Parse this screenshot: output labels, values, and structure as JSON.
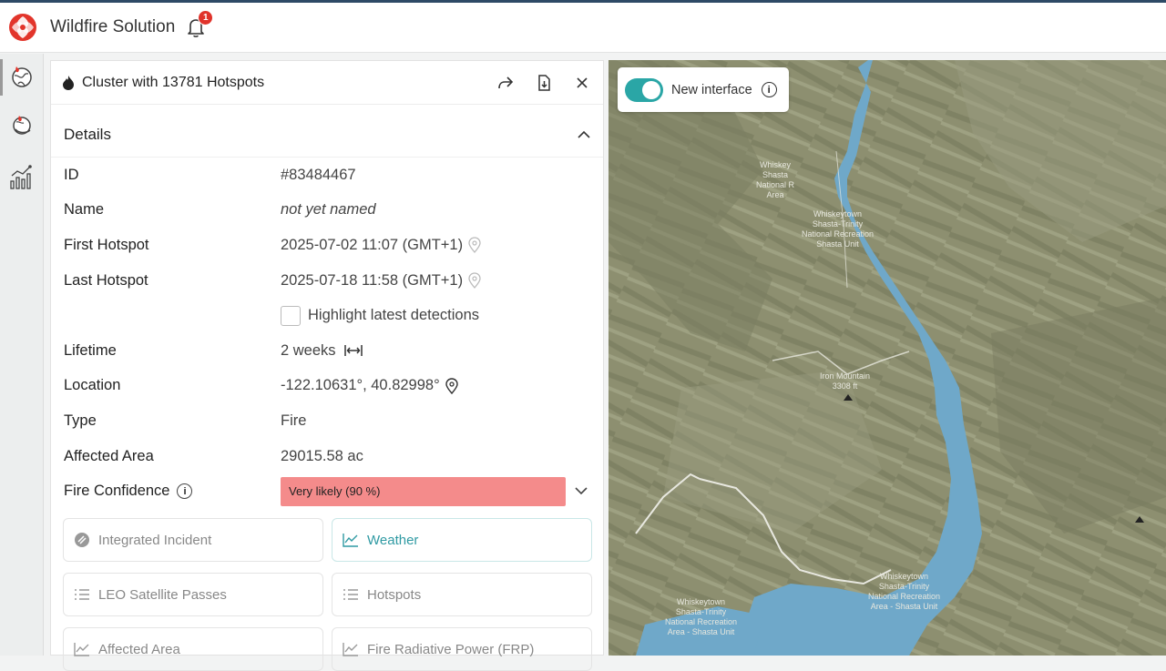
{
  "app": {
    "title": "Wildfire Solution",
    "notification_count": "1"
  },
  "panel": {
    "title": "Cluster with 13781 Hotspots",
    "section_title": "Details",
    "fields": {
      "id": {
        "label": "ID",
        "value": "#83484467"
      },
      "name": {
        "label": "Name",
        "value": "not yet named"
      },
      "first_hotspot": {
        "label": "First Hotspot",
        "value": "2025-07-02 11:07 (GMT+1)"
      },
      "last_hotspot": {
        "label": "Last Hotspot",
        "value": "2025-07-18 11:58 (GMT+1)"
      },
      "highlight": {
        "label": "Highlight latest detections"
      },
      "lifetime": {
        "label": "Lifetime",
        "value": "2 weeks"
      },
      "location": {
        "label": "Location",
        "value": "-122.10631°, 40.82998°"
      },
      "type": {
        "label": "Type",
        "value": "Fire"
      },
      "affected_area": {
        "label": "Affected Area",
        "value": "29015.58 ac"
      },
      "fire_confidence": {
        "label": "Fire Confidence",
        "value": "Very likely (90 %)",
        "percent": 90,
        "color": "#f48b8b"
      }
    },
    "cards": {
      "integrated_incident": "Integrated Incident",
      "weather": "Weather",
      "leo_passes": "LEO Satellite Passes",
      "hotspots": "Hotspots",
      "affected_area": "Affected Area",
      "frp": "Fire Radiative Power (FRP)"
    }
  },
  "map": {
    "toggle_label": "New interface",
    "labels": {
      "whiskeytown_1a": "Whiskey",
      "whiskeytown_1b": "Shasta",
      "whiskeytown_1c": "National R",
      "whiskeytown_1d": "Area",
      "whiskeytown_2a": "Whiskeytown",
      "whiskeytown_2b": "Shasta-Trinity",
      "whiskeytown_2c": "National Recreation",
      "whiskeytown_2d": "Shasta Unit",
      "mountain_a": "Iron Mountain",
      "mountain_b": "3308 ft",
      "whiskeytown_3a": "Whiskeytown",
      "whiskeytown_3b": "Shasta-Trinity",
      "whiskeytown_3c": "National Recreation",
      "whiskeytown_3d": "Area - Shasta Unit",
      "whiskeytown_4a": "Whiskeytown",
      "whiskeytown_4b": "Shasta-Trinity",
      "whiskeytown_4c": "National Recreation",
      "whiskeytown_4d": "Area - Shasta Unit"
    },
    "colors": {
      "terrain": "#8b8e6d",
      "water": "#6fa8c9",
      "accent": "#2aa6a6"
    }
  }
}
